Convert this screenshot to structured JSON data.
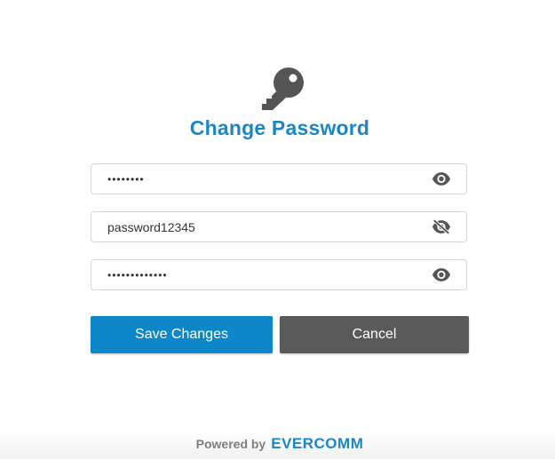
{
  "header": {
    "title": "Change Password",
    "icon": "key-icon"
  },
  "form": {
    "fields": [
      {
        "value": "••••••••",
        "masked": true,
        "toggle_icon": "eye-icon"
      },
      {
        "value": "password12345",
        "masked": false,
        "toggle_icon": "eye-slash-icon"
      },
      {
        "value": "•••••••••••••",
        "masked": true,
        "toggle_icon": "eye-icon"
      }
    ],
    "save_label": "Save Changes",
    "cancel_label": "Cancel"
  },
  "footer": {
    "powered_by": "Powered by",
    "brand": "EVERCOMM"
  },
  "colors": {
    "accent": "#1a87c4",
    "save_button": "#0e87c8",
    "cancel_button": "#5a5a5a",
    "icon": "#555555"
  }
}
